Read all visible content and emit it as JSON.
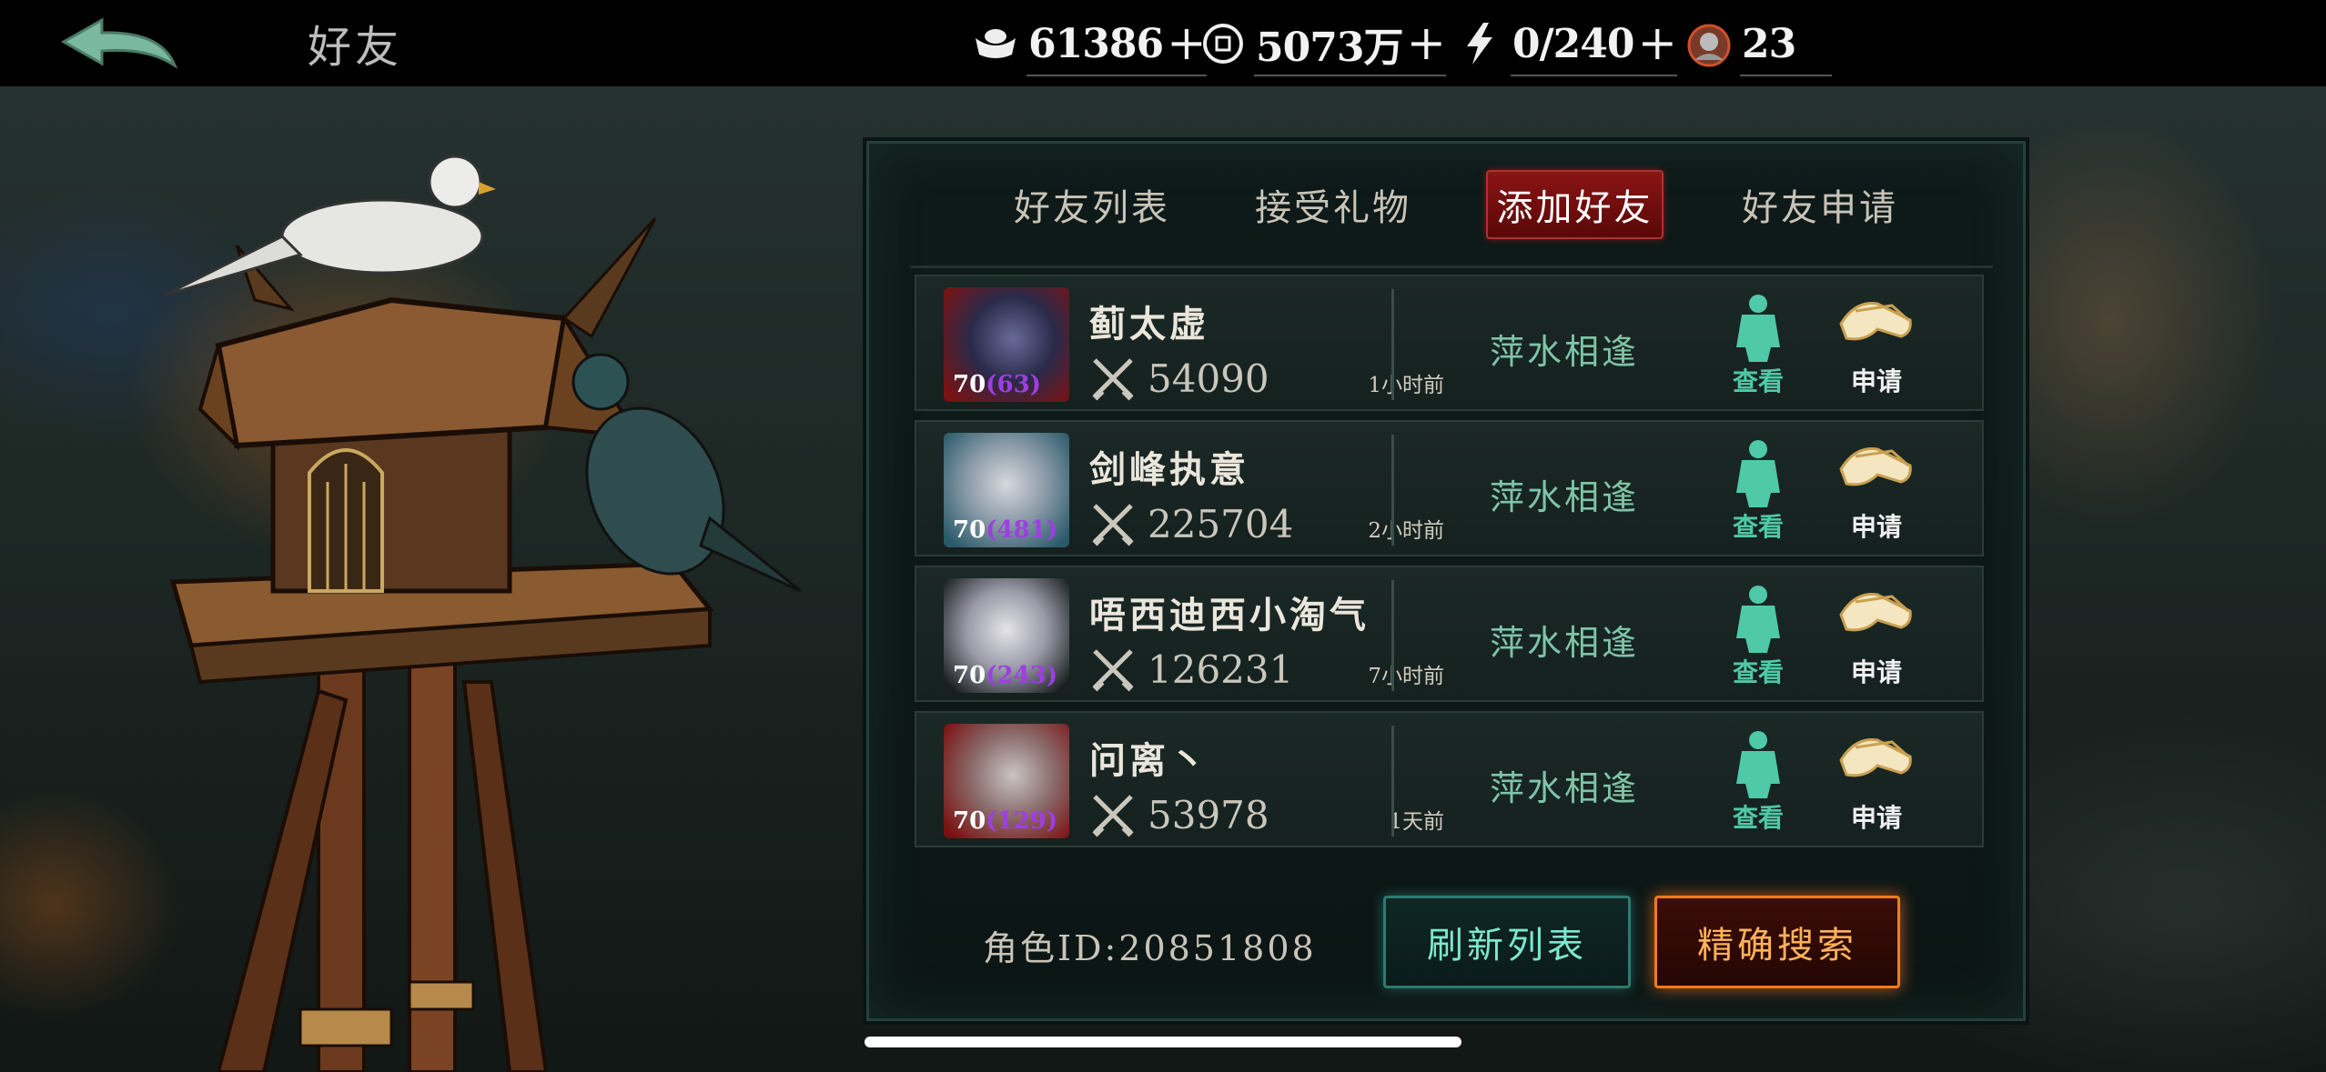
{
  "header": {
    "title": "好友",
    "resources": [
      {
        "icon": "silver-ingot-icon",
        "value": "61386"
      },
      {
        "icon": "copper-coin-icon",
        "value": "5073万"
      },
      {
        "icon": "lightning-stamina-icon",
        "value": "0/240"
      },
      {
        "icon": "character-token-icon",
        "value": "23"
      }
    ]
  },
  "tabs": [
    {
      "label": "好友列表",
      "active": false
    },
    {
      "label": "接受礼物",
      "active": false
    },
    {
      "label": "添加好友",
      "active": true
    },
    {
      "label": "好友申请",
      "active": false
    }
  ],
  "players": [
    {
      "name": "蓟太虚",
      "level": "70",
      "sub_level": "(63)",
      "power": "54090",
      "time": "1小时前",
      "status": "萍水相逢",
      "view_label": "查看",
      "apply_label": "申请"
    },
    {
      "name": "剑峰执意",
      "level": "70",
      "sub_level": "(481)",
      "power": "225704",
      "time": "2小时前",
      "status": "萍水相逢",
      "view_label": "查看",
      "apply_label": "申请"
    },
    {
      "name": "唔西迪西小淘气",
      "level": "70",
      "sub_level": "(243)",
      "power": "126231",
      "time": "7小时前",
      "status": "萍水相逢",
      "view_label": "查看",
      "apply_label": "申请"
    },
    {
      "name": "问离丶",
      "level": "70",
      "sub_level": "(129)",
      "power": "53978",
      "time": "1天前",
      "status": "萍水相逢",
      "view_label": "查看",
      "apply_label": "申请"
    }
  ],
  "footer": {
    "role_id": "角色ID:20851808",
    "refresh_label": "刷新列表",
    "search_label": "精确搜索"
  },
  "colors": {
    "active_tab": "#8a1414",
    "status_text": "#7fc4a8",
    "refresh_border": "#2d7a70",
    "search_border": "#ff7a1a"
  }
}
